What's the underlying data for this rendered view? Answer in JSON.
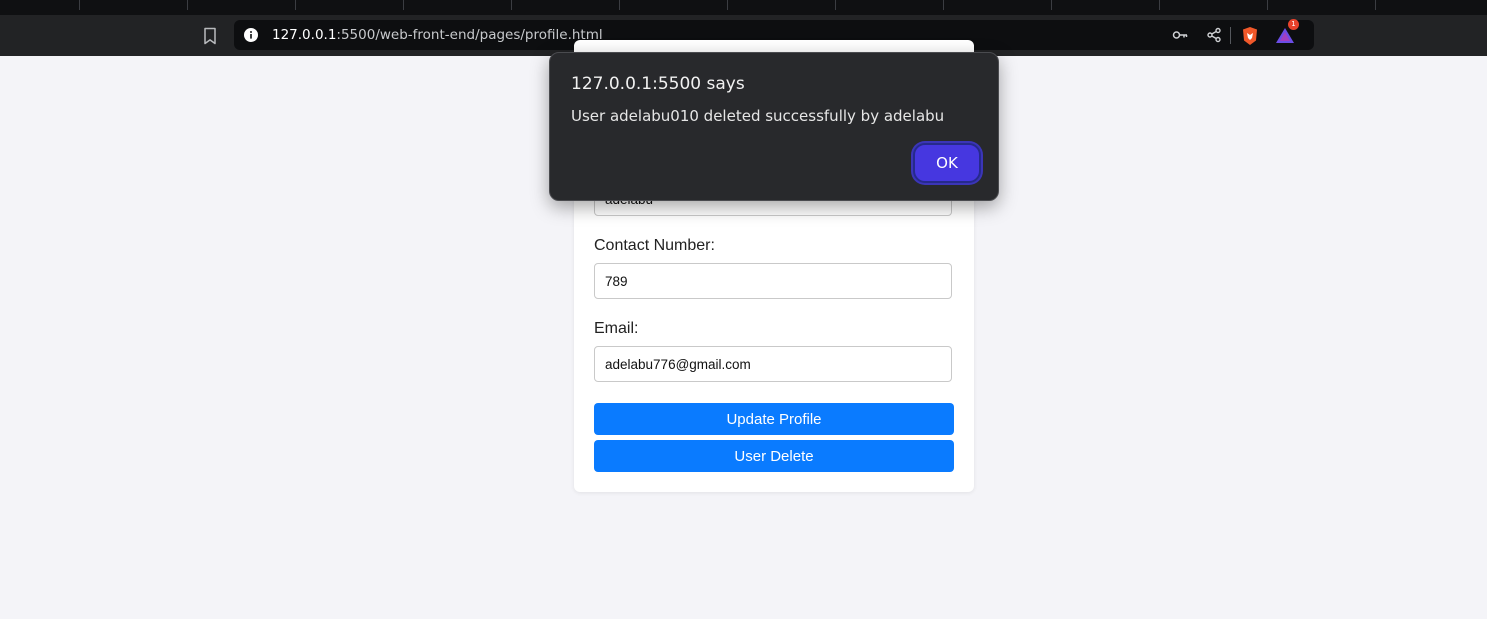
{
  "browser": {
    "address_bar": {
      "url_host": "127.0.0.1",
      "url_rest": ":5500/web-front-end/pages/profile.html"
    },
    "rewards_badge_count": "1",
    "icons": [
      "bookmark-icon",
      "site-info-icon",
      "password-key-icon",
      "share-icon",
      "brave-shields-icon",
      "brave-rewards-icon"
    ]
  },
  "profile_form": {
    "hidden_field_value": "adelabu",
    "contact_number_label": "Contact Number:",
    "contact_number_value": "789",
    "email_label": "Email:",
    "email_value": "adelabu776@gmail.com",
    "update_button_label": "Update Profile",
    "delete_button_label": "User Delete"
  },
  "alert_dialog": {
    "title": "127.0.0.1:5500 says",
    "message": "User adelabu010 deleted successfully by adelabu",
    "ok_label": "OK"
  },
  "colors": {
    "page_background": "#f4f4f8",
    "primary_button": "#0a7bff",
    "dialog_background": "#28292c",
    "dialog_ok_button": "#4637e0"
  }
}
